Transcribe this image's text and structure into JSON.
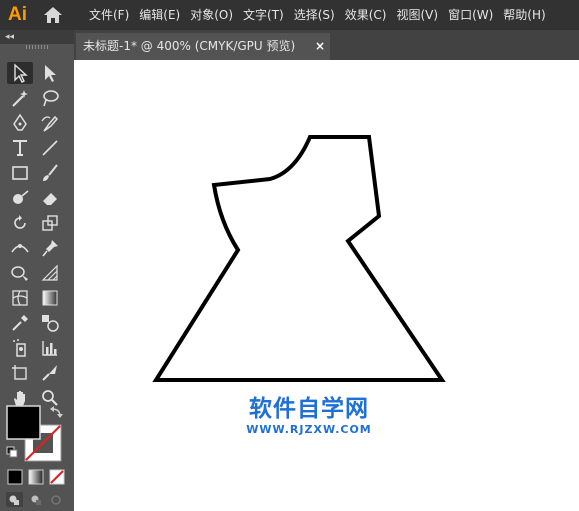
{
  "app": {
    "logo": "Ai"
  },
  "menu": [
    "文件(F)",
    "编辑(E)",
    "对象(O)",
    "文字(T)",
    "选择(S)",
    "效果(C)",
    "视图(V)",
    "窗口(W)",
    "帮助(H)"
  ],
  "toolbar": {
    "collapse": "◂◂"
  },
  "document_tab": {
    "title": "未标题-1* @ 400% (CMYK/GPU 预览)",
    "close": "×"
  },
  "watermark": {
    "title": "软件自学网",
    "url": "WWW.RJZXW.COM"
  },
  "colors": {
    "fill": "#000000",
    "stroke": "none",
    "accent": "#FF9A00",
    "watermark": "#1e6fd6"
  }
}
